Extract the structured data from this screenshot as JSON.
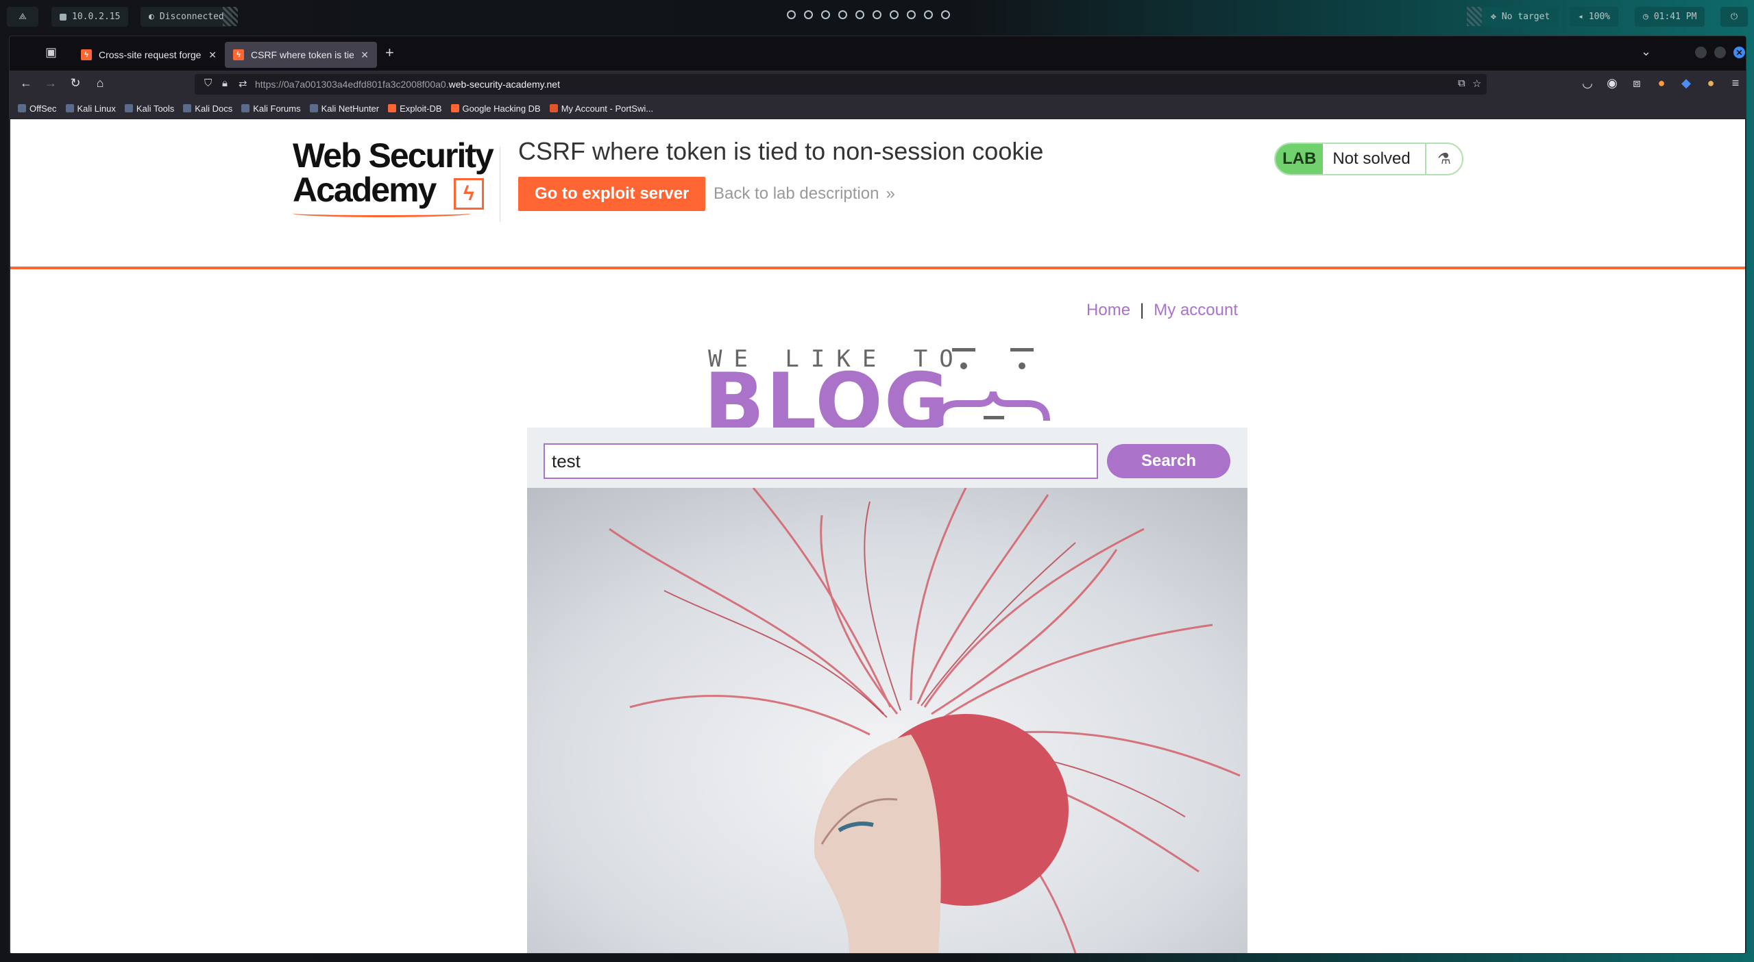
{
  "topbar": {
    "ip": "10.0.2.15",
    "vpn_status": "Disconnected",
    "target": "No target",
    "volume": "100%",
    "clock": "01:41 PM"
  },
  "browser": {
    "tabs": [
      {
        "label": "Cross-site request forgery",
        "active": false
      },
      {
        "label": "CSRF where token is tied to",
        "active": true
      }
    ],
    "url_prefix": "https://0a7a001303a4edfd801fa3c2008f00a0.",
    "url_domain": "web-security-academy.net",
    "bookmarks": [
      {
        "label": "OffSec",
        "icon": "offsec-icon"
      },
      {
        "label": "Kali Linux",
        "icon": "kali-icon"
      },
      {
        "label": "Kali Tools",
        "icon": "kali-tools-icon"
      },
      {
        "label": "Kali Docs",
        "icon": "kali-icon"
      },
      {
        "label": "Kali Forums",
        "icon": "kali-forums-icon"
      },
      {
        "label": "Kali NetHunter",
        "icon": "kali-icon"
      },
      {
        "label": "Exploit-DB",
        "icon": "exploitdb-icon"
      },
      {
        "label": "Google Hacking DB",
        "icon": "exploitdb-icon"
      },
      {
        "label": "My Account - PortSwi...",
        "icon": "portswigger-icon"
      }
    ]
  },
  "page": {
    "logo_line1": "Web Security",
    "logo_line2": "Academy",
    "lab_title": "CSRF where token is tied to non-session cookie",
    "exploit_button": "Go to exploit server",
    "back_link": "Back to lab description",
    "lab_badge": "LAB",
    "lab_status": "Not solved",
    "nav": {
      "home": "Home",
      "separator": "|",
      "account": "My account"
    },
    "blog_tagline": "WE LIKE TO",
    "blog_word": "BLOG",
    "search_value": "test",
    "search_button": "Search"
  },
  "colors": {
    "accent_orange": "#ff6633",
    "blog_purple": "#aa72c8",
    "lab_green": "#70d16d"
  }
}
